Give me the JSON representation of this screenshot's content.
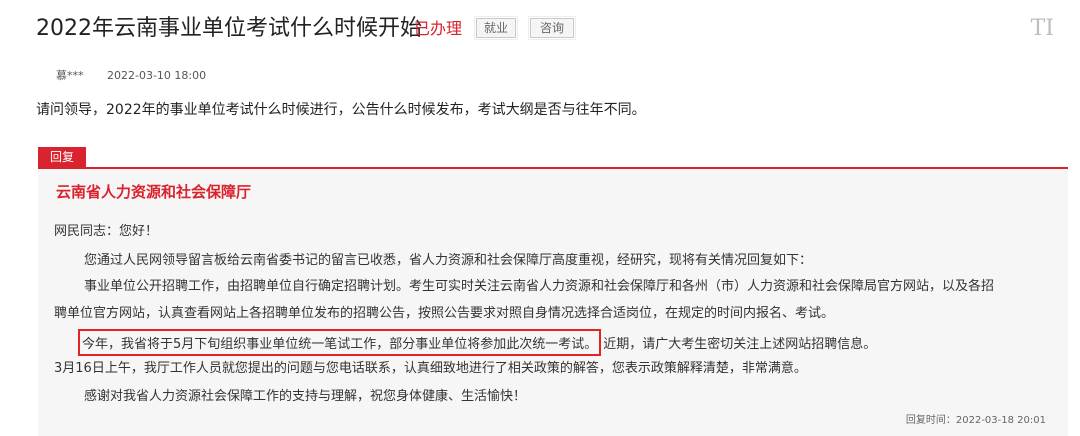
{
  "header": {
    "title": "2022年云南事业单位考试什么时候开始",
    "status": "已办理",
    "tags": [
      "就业",
      "咨询"
    ],
    "font_tool_label": "TI"
  },
  "meta": {
    "author": "慕***",
    "date": "2022-03-10 18:00"
  },
  "question": "请问领导，2022年的事业单位考试什么时候进行，公告什么时候发布，考试大纲是否与往年不同。",
  "reply": {
    "label": "回复",
    "org": "云南省人力资源和社会保障厅",
    "greeting": "网民同志：您好！",
    "para1": "您通过人民网领导留言板给云南省委书记的留言已收悉，省人力资源和社会保障厅高度重视，经研究，现将有关情况回复如下：",
    "para2_line1": "事业单位公开招聘工作，由招聘单位自行确定招聘计划。考生可实时关注云南省人力资源和社会保障厅和各州（市）人力资源和社会保障局官方网站，以及各招",
    "para2_line2": "聘单位官方网站，认真查看网站上各招聘单位发布的招聘公告，按照公告要求对照自身情况选择合适岗位，在规定的时间内报名、考试。",
    "para3_highlight": "今年，我省将于5月下旬组织事业单位统一笔试工作，部分事业单位将参加此次统一考试。",
    "para3_rest": "近期，请广大考生密切关注上述网站招聘信息。",
    "para4": "3月16日上午，我厅工作人员就您提出的问题与您电话联系，认真细致地进行了相关政策的解答，您表示政策解释清楚，非常满意。",
    "para5": "感谢对我省人力资源社会保障工作的支持与理解，祝您身体健康、生活愉快！",
    "reply_time": "回复时间：2022-03-18 20:01"
  },
  "colors": {
    "accent_red": "#d9232e",
    "reply_background": "#f6f6f6"
  }
}
